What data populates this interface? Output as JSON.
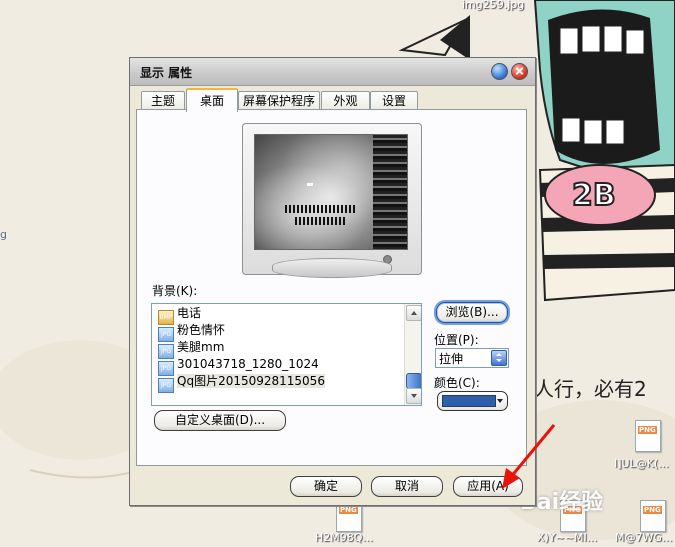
{
  "desktop": {
    "top_file_label": "img259.jpg",
    "sticker_text": "2B",
    "handwriting": "人行，必有2",
    "left_edge_label": "g",
    "icons": [
      {
        "label": "I]UL@K(...",
        "ext": "PNG"
      },
      {
        "label": "H2M98Q...",
        "ext": "PNG"
      },
      {
        "label": "X)Y~~MI...",
        "ext": "PNG"
      },
      {
        "label": "M@7WG...",
        "ext": "PNG"
      }
    ],
    "watermark": "Bai经验"
  },
  "dialog": {
    "title": "显示 属性",
    "tabs": [
      "主题",
      "桌面",
      "屏幕保护程序",
      "外观",
      "设置"
    ],
    "active_tab_index": 1,
    "background_label": "背景(K):",
    "background_items": [
      {
        "name": "电话",
        "icon": "bmp-file-icon",
        "ext": "BMP"
      },
      {
        "name": "粉色情怀",
        "icon": "jpg-file-icon",
        "ext": "JPG"
      },
      {
        "name": "美腿mm",
        "icon": "jpg-file-icon",
        "ext": "JPG"
      },
      {
        "name": "301043718_1280_1024",
        "icon": "jpg-file-icon",
        "ext": "JPG"
      },
      {
        "name": "Qq图片20150928115056",
        "icon": "jpg-file-icon",
        "ext": "JPG"
      }
    ],
    "selected_item_index": 4,
    "browse_label": "浏览(B)...",
    "position_label": "位置(P):",
    "position_value": "拉伸",
    "color_label": "颜色(C):",
    "color_value": "#2e5fa8",
    "customize_label": "自定义桌面(D)...",
    "ok_label": "确定",
    "cancel_label": "取消",
    "apply_label": "应用(A)"
  },
  "annotation": {
    "arrow_color": "#e8140c"
  }
}
